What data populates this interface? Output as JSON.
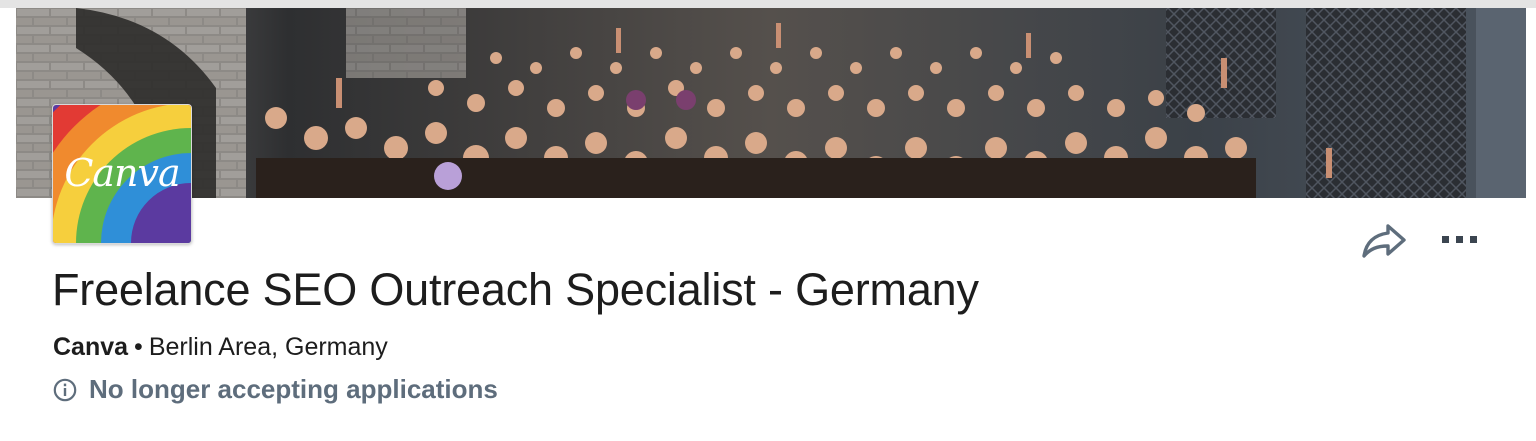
{
  "job": {
    "title": "Freelance SEO Outreach Specialist - Germany",
    "company": "Canva",
    "separator": "•",
    "location": "Berlin Area, Germany",
    "status": "No longer accepting applications"
  },
  "logo": {
    "text": "Canva",
    "icon": "canva-rainbow-logo"
  },
  "actions": {
    "share_icon": "share-arrow-icon",
    "more_icon": "more-options-icon"
  },
  "banner": {
    "icon": "team-crowd-photo"
  },
  "colors": {
    "status_text": "#5e6d7c",
    "title_text": "#1d1d1d",
    "icon_gray": "#5e6d7c"
  }
}
